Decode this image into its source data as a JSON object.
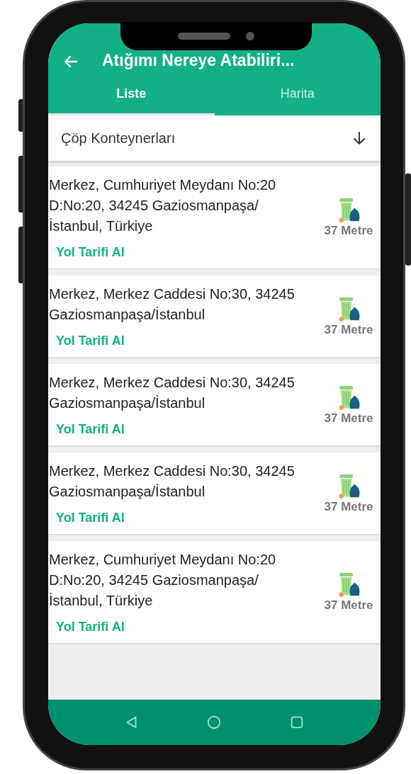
{
  "app_bar": {
    "title": "Atığımı Nereye Atabiliri..."
  },
  "tabs": [
    {
      "label": "Liste",
      "selected": true
    },
    {
      "label": "Harita",
      "selected": false
    }
  ],
  "filter": {
    "value": "Çöp Konteynerları"
  },
  "locations": [
    {
      "address": "Merkez, Cumhuriyet Meydanı No:20 D:No:20, 34245 Gaziosmanpaşa/İstanbul, Türkiye",
      "action": "Yol Tarifi Al",
      "distance": "37 Metre"
    },
    {
      "address": "Merkez, Merkez Caddesi No:30, 34245 Gaziosmanpaşa/İstanbul",
      "action": "Yol Tarifi Al",
      "distance": "37 Metre"
    },
    {
      "address": "Merkez, Merkez Caddesi No:30, 34245 Gaziosmanpaşa/İstanbul",
      "action": "Yol Tarifi Al",
      "distance": "37 Metre"
    },
    {
      "address": "Merkez, Merkez Caddesi No:30, 34245 Gaziosmanpaşa/İstanbul",
      "action": "Yol Tarifi Al",
      "distance": "37 Metre"
    },
    {
      "address": "Merkez, Cumhuriyet Meydanı No:20 D:No:20, 34245 Gaziosmanpaşa/İstanbul, Türkiye",
      "action": "Yol Tarifi Al",
      "distance": "37 Metre"
    }
  ]
}
